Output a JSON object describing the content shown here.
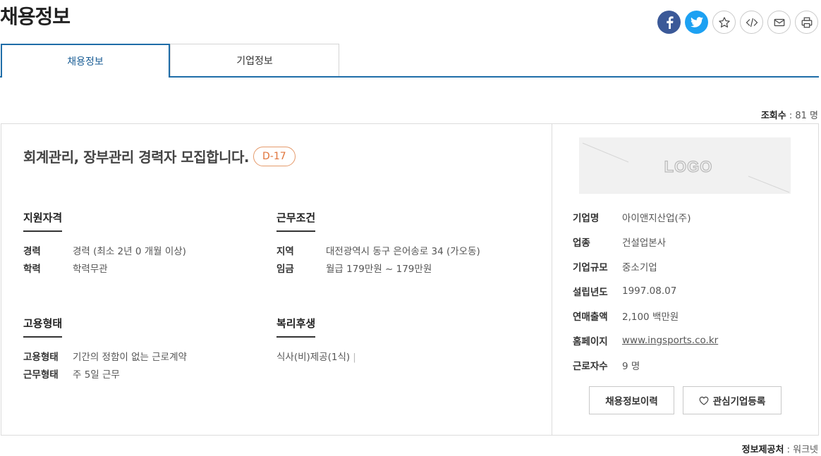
{
  "page": {
    "title": "채용정보"
  },
  "share": {
    "buttons": [
      {
        "name": "facebook-icon"
      },
      {
        "name": "twitter-icon"
      },
      {
        "name": "star-icon"
      },
      {
        "name": "code-icon"
      },
      {
        "name": "mail-icon"
      },
      {
        "name": "print-icon"
      }
    ]
  },
  "tabs": [
    {
      "label": "채용정보",
      "active": true
    },
    {
      "label": "기업정보",
      "active": false
    }
  ],
  "views": {
    "label": "조회수",
    "sep": " : ",
    "value": "81 명"
  },
  "job": {
    "title": "회계관리, 장부관리 경력자 모집합니다.",
    "dday": "D-17"
  },
  "sections": {
    "qualification": {
      "heading": "지원자격",
      "rows": [
        {
          "k": "경력",
          "v": "경력 (최소 2년 0 개월 이상)"
        },
        {
          "k": "학력",
          "v": "학력무관"
        }
      ]
    },
    "conditions": {
      "heading": "근무조건",
      "rows": [
        {
          "k": "지역",
          "v": "대전광역시 동구 은어송로 34 (가오동)"
        },
        {
          "k": "임금",
          "v": "월급 179만원 ~ 179만원"
        }
      ]
    },
    "employment": {
      "heading": "고용형태",
      "rows": [
        {
          "k": "고용형태",
          "v": "기간의 정함이 없는 근로계약"
        },
        {
          "k": "근무형태",
          "v": "주 5일 근무"
        }
      ]
    },
    "welfare": {
      "heading": "복리후생",
      "value": "식사(비)제공(1식)",
      "sep": "|"
    }
  },
  "company": {
    "logo_text": "LOGO",
    "rows": [
      {
        "k": "기업명",
        "v": "아이앤지산업(주)"
      },
      {
        "k": "업종",
        "v": "건설업본사"
      },
      {
        "k": "기업규모",
        "v": "중소기업"
      },
      {
        "k": "설립년도",
        "v": "1997.08.07"
      },
      {
        "k": "연매출액",
        "v": "2,100 백만원"
      },
      {
        "k": "홈페이지",
        "v": "www.ingsports.co.kr"
      },
      {
        "k": "근로자수",
        "v": "9 명"
      }
    ],
    "history_button": "채용정보이력",
    "fav_button": "관심기업등록"
  },
  "provider": {
    "label": "정보제공처",
    "sep": " : ",
    "value": "워크넷"
  },
  "colors": {
    "accent": "#1f6da8",
    "dday": "#e0743b",
    "facebook": "#3b5998",
    "twitter": "#1da1f2"
  }
}
